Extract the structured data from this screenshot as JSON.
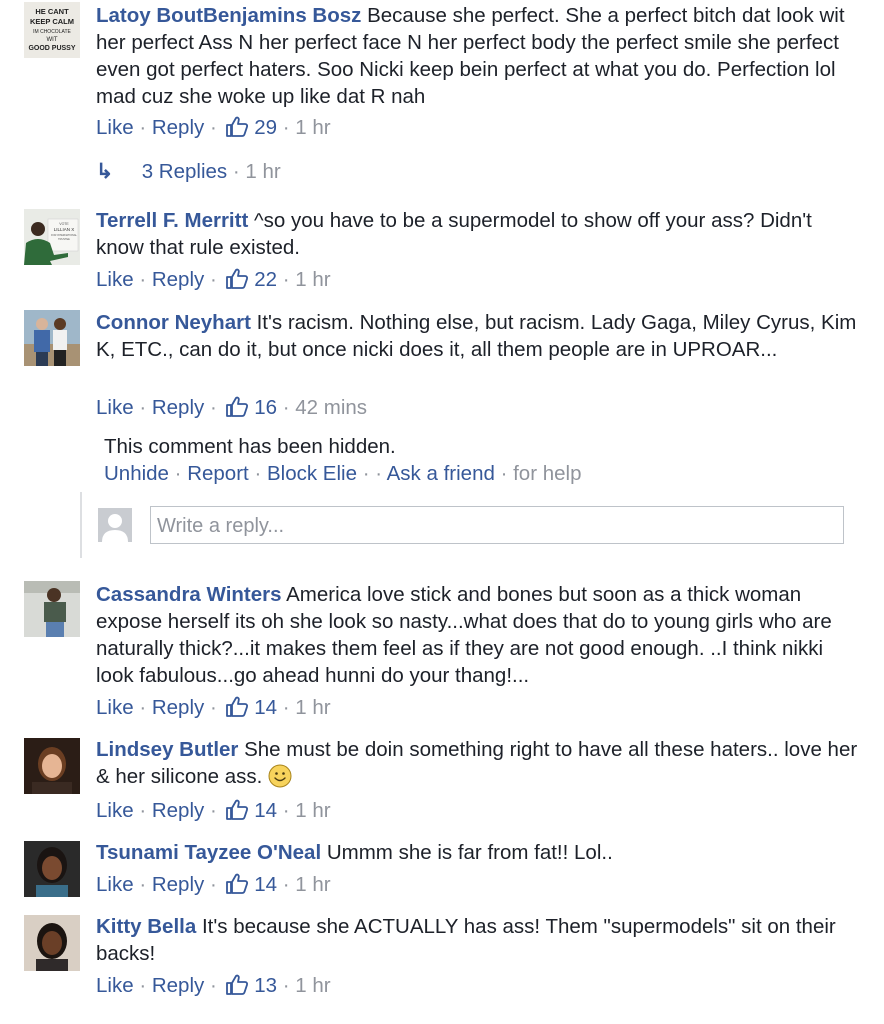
{
  "comments": [
    {
      "author": "Latoy BoutBenjamins Bosz",
      "text": "Because she perfect. She a perfect bitch dat look wit her perfect Ass N her perfect face N her perfect body the perfect smile she perfect even got perfect haters. Soo Nicki keep bein perfect at what you do. Perfection lol mad cuz she woke up like dat R nah",
      "like": "Like",
      "reply": "Reply",
      "likes": "29",
      "time": "1 hr",
      "avatar_text": [
        "HE CANT",
        "KEEP CALM",
        "IM CHOCOLATE",
        "WIT",
        "GOOD PUSSY"
      ]
    },
    {
      "author": "Terrell F. Merritt",
      "text": "^so you have to be a supermodel to show off your ass? Didn't know that rule existed.",
      "like": "Like",
      "reply": "Reply",
      "likes": "22",
      "time": "1 hr",
      "avatar_text": [
        "VOTE",
        "LILLIAN X",
        "FOR INTERNATIONAL",
        "TRUSTEE"
      ]
    },
    {
      "author": "Connor Neyhart",
      "text": "It's racism. Nothing else, but racism. Lady Gaga, Miley Cyrus, Kim K, ETC., can do it, but once nicki does it, all them people are in UPROAR...",
      "like": "Like",
      "reply": "Reply",
      "likes": "16",
      "time": "42 mins"
    },
    {
      "author": "Cassandra Winters",
      "text": "America love stick and bones but soon as a thick woman expose herself its oh she look so nasty...what does that do to young girls who are naturally thick?...it makes them feel as if they are not good enough. ..I think nikki look fabulous...go ahead hunni do your thang!...",
      "like": "Like",
      "reply": "Reply",
      "likes": "14",
      "time": "1 hr"
    },
    {
      "author": "Lindsey Butler",
      "text": "She must be doin something right to have all these haters.. love her & her silicone ass.",
      "like": "Like",
      "reply": "Reply",
      "likes": "14",
      "time": "1 hr"
    },
    {
      "author": "Tsunami Tayzee O'Neal",
      "text": "Ummm she is far from fat!! Lol..",
      "like": "Like",
      "reply": "Reply",
      "likes": "14",
      "time": "1 hr"
    },
    {
      "author": "Kitty Bella",
      "text": "It's because she ACTUALLY has ass! Them \"supermodels\" sit on their backs!",
      "like": "Like",
      "reply": "Reply",
      "likes": "13",
      "time": "1 hr"
    }
  ],
  "replies_link": {
    "label": "3 Replies",
    "time": "1 hr"
  },
  "hidden_comment": {
    "message": "This comment has been hidden.",
    "unhide": "Unhide",
    "report": "Report",
    "block": "Block Elie",
    "ask": "Ask a friend",
    "help": "for help"
  },
  "reply_box": {
    "placeholder": "Write a reply..."
  },
  "colors": {
    "link": "#365899",
    "meta": "#90949c",
    "text": "#1d2129"
  }
}
